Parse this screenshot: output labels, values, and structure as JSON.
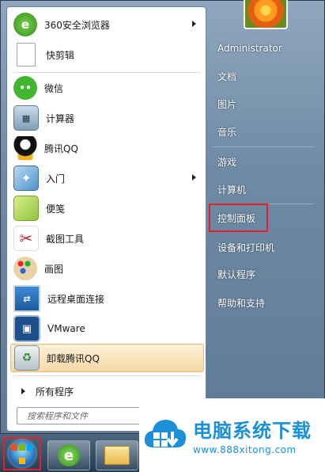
{
  "start_menu": {
    "programs": [
      {
        "label": "360安全浏览器",
        "icon": "360-browser-icon",
        "has_submenu": true
      },
      {
        "label": "快剪辑",
        "icon": "document-icon",
        "has_submenu": false
      },
      {
        "label": "微信",
        "icon": "wechat-icon",
        "has_submenu": false
      },
      {
        "label": "计算器",
        "icon": "calculator-icon",
        "has_submenu": false
      },
      {
        "label": "腾讯QQ",
        "icon": "qq-penguin-icon",
        "has_submenu": false
      },
      {
        "label": "入门",
        "icon": "getting-started-icon",
        "has_submenu": true
      },
      {
        "label": "便笺",
        "icon": "sticky-notes-icon",
        "has_submenu": false
      },
      {
        "label": "截图工具",
        "icon": "snipping-tool-icon",
        "has_submenu": false
      },
      {
        "label": "画图",
        "icon": "paint-icon",
        "has_submenu": false
      },
      {
        "label": "远程桌面连接",
        "icon": "remote-desktop-icon",
        "has_submenu": false
      },
      {
        "label": "VMware",
        "icon": "vmware-icon",
        "has_submenu": false
      },
      {
        "label": "卸载腾讯QQ",
        "icon": "recycle-bin-icon",
        "has_submenu": false,
        "highlighted": true
      }
    ],
    "all_programs_label": "所有程序",
    "search_placeholder": "搜索程序和文件",
    "right_items": [
      {
        "label": "Administrator"
      },
      {
        "label": "文档"
      },
      {
        "label": "图片"
      },
      {
        "label": "音乐"
      },
      {
        "label": "游戏"
      },
      {
        "label": "计算机"
      },
      {
        "label": "控制面板",
        "boxed": true
      },
      {
        "label": "设备和打印机"
      },
      {
        "label": "默认程序"
      },
      {
        "label": "帮助和支持"
      }
    ]
  },
  "taskbar": {
    "items": [
      "start-orb-icon",
      "ie-browser-icon",
      "file-explorer-icon"
    ]
  },
  "watermark": {
    "title": "电脑系统下载",
    "url": "www.888xitong.com"
  },
  "colors": {
    "highlight": "#f8d9a6",
    "red_box": "#e3202a",
    "watermark_blue": "#1b8fd8"
  }
}
